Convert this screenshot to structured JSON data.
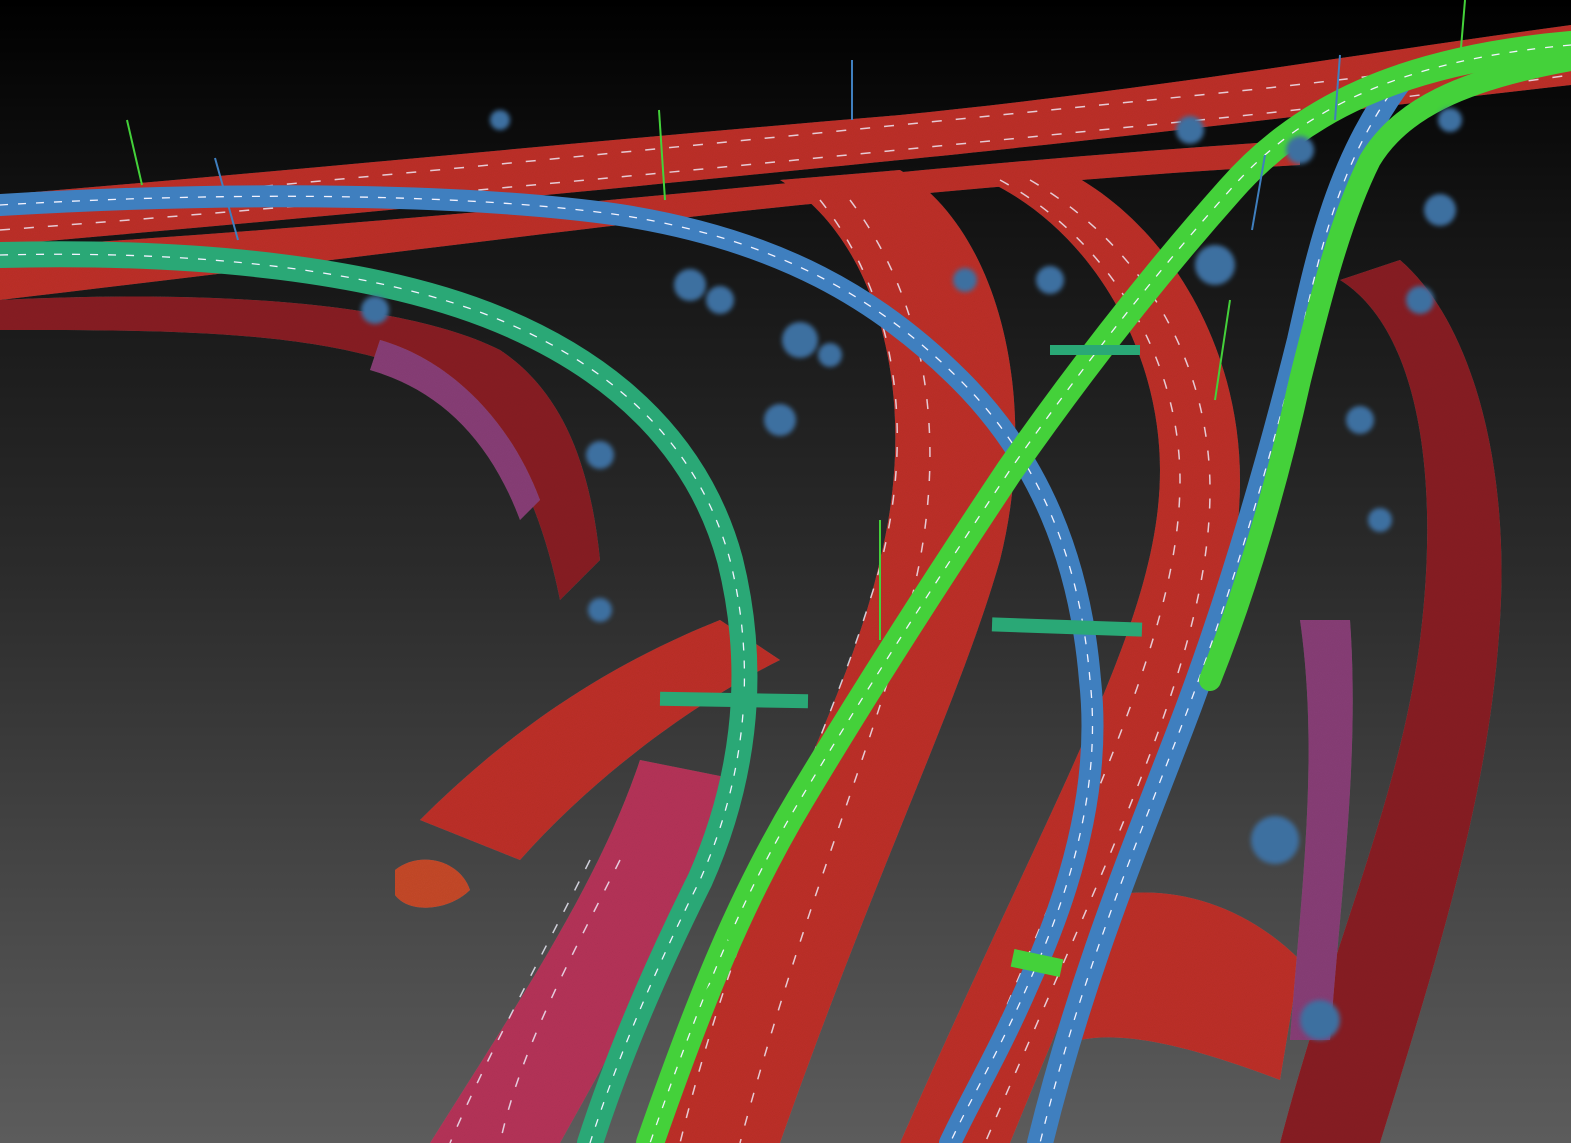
{
  "scene": {
    "subject": "lidar-point-cloud-highway-interchange",
    "colormap": "elevation",
    "colors": {
      "background_top": "#000000",
      "background_bottom": "#5c5c5c",
      "ground_level": "#c0302a",
      "ground_shadow": "#8a1f24",
      "low_level": "#b8345a",
      "mid_low_level": "#8a3f78",
      "mid_level": "#3f7fbf",
      "mid_high_level": "#2aa876",
      "high_level": "#44d13a",
      "lane_marking": "#f2f2ff",
      "vegetation": "#3d6fa0"
    },
    "layers": [
      {
        "id": "ground-highway",
        "level": "ground_level"
      },
      {
        "id": "underpass-ramps",
        "level": "low_level"
      },
      {
        "id": "blue-flyover-left",
        "level": "mid_level"
      },
      {
        "id": "blue-flyover-right",
        "level": "mid_level"
      },
      {
        "id": "green-flyover-left",
        "level": "mid_high_level"
      },
      {
        "id": "green-flyover-center",
        "level": "high_level"
      },
      {
        "id": "green-flyover-right",
        "level": "high_level"
      },
      {
        "id": "trees",
        "level": "vegetation"
      },
      {
        "id": "light-poles",
        "level": "mixed"
      }
    ]
  }
}
